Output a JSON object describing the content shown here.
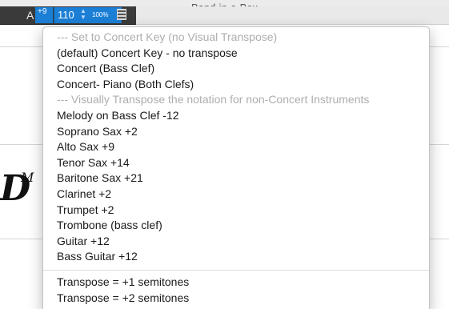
{
  "app": {
    "title": "Band-in-a-Box"
  },
  "toolbar": {
    "key": "A",
    "transpose_badge": "+9",
    "tempo": "110",
    "tempo_percent": "100%",
    "stepper_up": "▲",
    "stepper_down": "▼"
  },
  "notation": {
    "chord_fragment": "D",
    "chord_suffix": "M"
  },
  "menu": {
    "selected": "Alto Sax +9",
    "items": [
      {
        "label": "--- Set to Concert Key (no Visual Transpose)",
        "type": "header"
      },
      {
        "label": "(default) Concert Key - no transpose",
        "type": "item"
      },
      {
        "label": "Concert (Bass Clef)",
        "type": "item"
      },
      {
        "label": "Concert- Piano (Both Clefs)",
        "type": "item"
      },
      {
        "label": "--- Visually Transpose the notation for non-Concert Instruments",
        "type": "header"
      },
      {
        "label": "Melody on Bass Clef -12",
        "type": "item"
      },
      {
        "label": "Soprano Sax +2",
        "type": "item"
      },
      {
        "label": "Alto Sax +9",
        "type": "item",
        "checked": true
      },
      {
        "label": "Tenor Sax +14",
        "type": "item"
      },
      {
        "label": "Baritone Sax +21",
        "type": "item"
      },
      {
        "label": "Clarinet +2",
        "type": "item"
      },
      {
        "label": "Trumpet +2",
        "type": "item"
      },
      {
        "label": "Trombone (bass clef)",
        "type": "item"
      },
      {
        "label": "Guitar +12",
        "type": "item"
      },
      {
        "label": "Bass Guitar +12",
        "type": "item"
      },
      {
        "type": "separator"
      },
      {
        "label": "Transpose = +1 semitones",
        "type": "item"
      },
      {
        "label": "Transpose = +2 semitones",
        "type": "item"
      }
    ]
  }
}
